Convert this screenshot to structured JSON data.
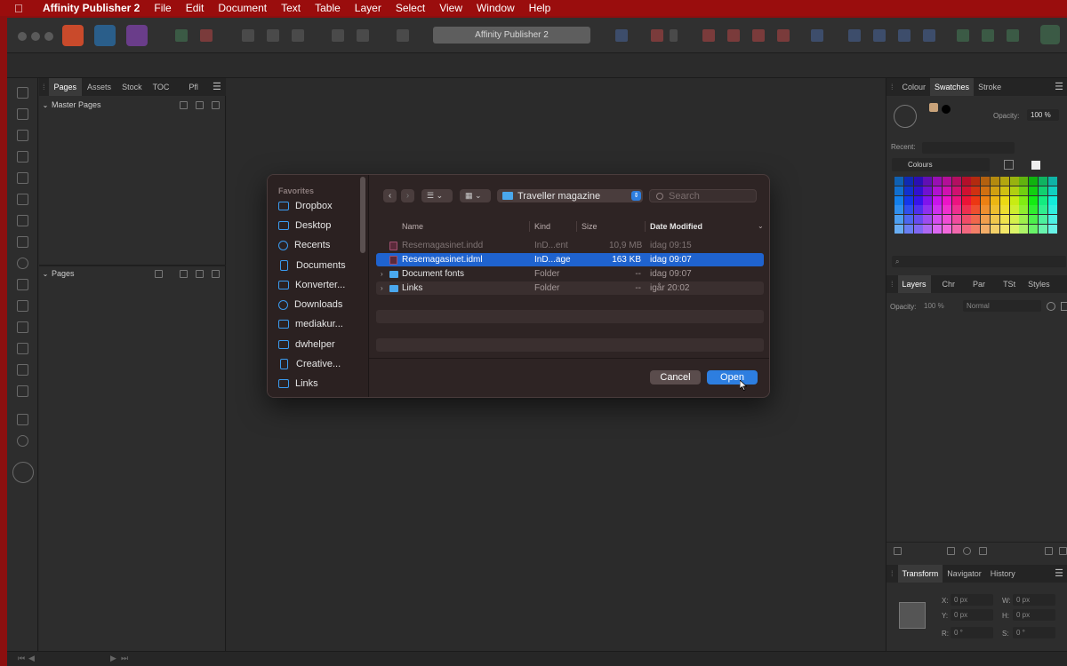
{
  "menubar": {
    "apple_icon": "apple-icon",
    "items": [
      "Affinity Publisher 2",
      "File",
      "Edit",
      "Document",
      "Text",
      "Table",
      "Layer",
      "Select",
      "View",
      "Window",
      "Help"
    ]
  },
  "toolbar": {
    "document_title": "Affinity Publisher 2"
  },
  "left_panel": {
    "tabs": [
      "Pages",
      "Assets",
      "Stock",
      "TOC",
      "Pfl"
    ],
    "active_tab": "Pages",
    "master_pages_label": "Master Pages",
    "pages_label": "Pages"
  },
  "right_panel": {
    "tabs": [
      "Colour",
      "Swatches",
      "Stroke"
    ],
    "active_tab": "Swatches",
    "opacity_label": "Opacity:",
    "opacity_value": "100 %",
    "recent_label": "Recent:",
    "palette_name": "Colours",
    "layers_tabs": [
      "Layers",
      "Chr",
      "Par",
      "TSt",
      "Styles"
    ],
    "layers_opacity_label": "Opacity:",
    "layers_opacity_value": "100 %",
    "blend_mode": "Normal",
    "transform_tabs": [
      "Transform",
      "Navigator",
      "History"
    ],
    "transform": {
      "x_label": "X:",
      "x_value": "0 px",
      "y_label": "Y:",
      "y_value": "0 px",
      "w_label": "W:",
      "w_value": "0 px",
      "h_label": "H:",
      "h_value": "0 px",
      "r_label": "R:",
      "r_value": "0 °",
      "s_label": "S:",
      "s_value": "0 °"
    }
  },
  "dialog": {
    "sidebar_heading": "Favorites",
    "favorites": [
      {
        "label": "Dropbox",
        "icon": "folder-icon"
      },
      {
        "label": "Desktop",
        "icon": "desktop-icon"
      },
      {
        "label": "Recents",
        "icon": "clock-icon"
      },
      {
        "label": "Documents",
        "icon": "document-icon"
      },
      {
        "label": "Konverter...",
        "icon": "folder-icon"
      },
      {
        "label": "Downloads",
        "icon": "download-icon"
      },
      {
        "label": "mediakur...",
        "icon": "home-icon"
      },
      {
        "label": "dwhelper",
        "icon": "folder-icon"
      },
      {
        "label": "Creative...",
        "icon": "document-icon"
      },
      {
        "label": "Links",
        "icon": "folder-icon"
      }
    ],
    "location": "Traveller magazine",
    "search_placeholder": "Search",
    "columns": [
      "Name",
      "Kind",
      "Size",
      "Date Modified"
    ],
    "files": [
      {
        "name": "Resemagasinet.indd",
        "kind": "InD...ent",
        "size": "10,9 MB",
        "date": "idag 09:15",
        "type": "indd",
        "dimmed": true,
        "selected": false
      },
      {
        "name": "Resemagasinet.idml",
        "kind": "InD...age",
        "size": "163 KB",
        "date": "idag 09:07",
        "type": "indd",
        "dimmed": false,
        "selected": true
      },
      {
        "name": "Document fonts",
        "kind": "Folder",
        "size": "--",
        "date": "idag 09:07",
        "type": "folder",
        "dimmed": false,
        "selected": false
      },
      {
        "name": "Links",
        "kind": "Folder",
        "size": "--",
        "date": "igår 20:02",
        "type": "folder",
        "dimmed": false,
        "selected": false
      }
    ],
    "cancel_label": "Cancel",
    "open_label": "Open"
  },
  "colors": {
    "accent": "#2d7ee0",
    "selection": "#1f63cf",
    "menubar": "#9a0d0d"
  }
}
